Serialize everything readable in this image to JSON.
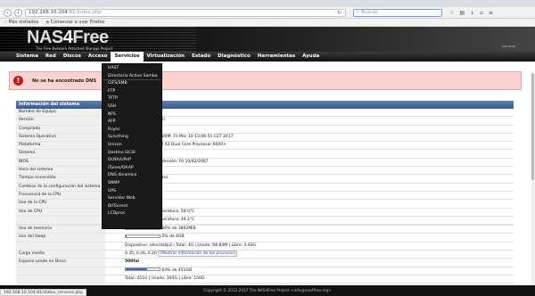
{
  "browser": {
    "url_main": "192.168.10.104",
    "url_rest": ":81/index.php",
    "search_placeholder": "Buscar",
    "bookmarks": [
      "Más visitados",
      "Comenzar a usar Firefox"
    ]
  },
  "header": {
    "logo_pre": "NAS",
    "logo_four": "4",
    "logo_post": "Free",
    "tagline": "The Free Network Attached Storage Project",
    "host_label": "nas.local"
  },
  "menu": [
    "Sistema",
    "Red",
    "Discos",
    "Acceso",
    "Servicios",
    "Virtualización",
    "Estado",
    "Diagnóstico",
    "Herramientas",
    "Ayuda"
  ],
  "error": {
    "text": "No se ha encontrado DNS"
  },
  "panel": {
    "title": "Información del sistema"
  },
  "rows": [
    {
      "label": "Nombre de Equipo",
      "value": ""
    },
    {
      "label": "Versión",
      "value": "dina (revisión 4026)"
    },
    {
      "label": "Compilado",
      "value": "1:29:21 UTC 2017"
    },
    {
      "label": "Sistema Operativo",
      "value": "EASE-p8 #0 r315000M: Fri Mar 10 13:06:51 CET 2017"
    },
    {
      "label": "Plataforma",
      "value": "AMD Athlon(tm) 64 X2 Dual Core Processor 6000+"
    },
    {
      "label": "Sistema",
      "value": "Co., Ltd. M61P-S3"
    },
    {
      "label": "BIOS",
      "value": "International, Inc. Versión: F6 10/02/2007"
    },
    {
      "label": "Hora del sistema",
      "value": "03:17 UTC 2017"
    },
    {
      "label": "Tiempo encendido",
      "value": "Minutos 10 Segundos"
    },
    {
      "label": "Cambios de la configuración del sistema",
      "value": "0:59:22 UTC 2017"
    },
    {
      "label": "Frecuencia de la CPU",
      "value": ""
    },
    {
      "label": "Uso de la CPU",
      "value": "0%"
    },
    {
      "label": "Uso de CPU",
      "value": "Núcleo 0:   0%  Temperatura: 50.0°C"
    },
    {
      "label": "",
      "value": "Núcleo 1:   0%  Temperatura: 44.1°C"
    },
    {
      "label": "",
      "value": ""
    },
    {
      "label": "Uso de memoria",
      "value": "26% de 3862MiB"
    },
    {
      "label": "Uso del Swap",
      "value": "2% de 4GB"
    },
    {
      "label": "",
      "value": "Dispositivo: /dev/dalip3 | Total: 4G | Usado: 68.84M | Libre: 3.93G"
    },
    {
      "label": "Carga media",
      "value": "0.35, 0.26, 0.20"
    },
    {
      "label": "Espacio usado en Disco",
      "value": "500fal"
    },
    {
      "label": "",
      "value": "64% de 451GB"
    },
    {
      "label": "",
      "value": "Total: 451G | Usado: 265G | Libre: 150G"
    }
  ],
  "load_link": "[Mostrar información de los procesos]",
  "bars": {
    "memory": 0.26,
    "swap": 0.02,
    "disk": 0.64
  },
  "dropdown": [
    "HAST",
    "Directorio Activo Samba",
    "CIFS/SMB",
    "FTP",
    "TFTP",
    "SSH",
    "NFS",
    "AFP",
    "Rsync",
    "Syncthing",
    "Unison",
    "Destino iSCSI",
    "DLNA/UPnP",
    "iTunes/DAAP",
    "DNS dinamico",
    "SNMP",
    "UPS",
    "Servidor Web",
    "BitTorrent",
    "LCDproc"
  ],
  "footer": "Copyright © 2012-2017 The NAS4Free Project <info@nas4free.org>",
  "status_url": "192.168.10.104:81/status_services.php"
}
